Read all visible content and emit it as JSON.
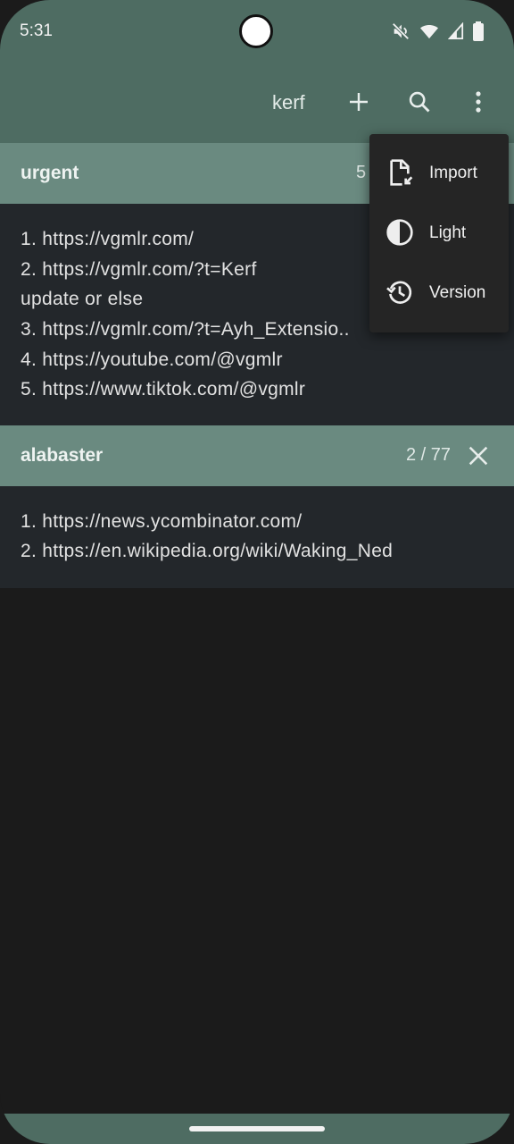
{
  "status_bar": {
    "time": "5:31"
  },
  "app_bar": {
    "title": "kerf"
  },
  "menu": {
    "items": [
      {
        "label": "Import",
        "icon": "file-import-icon"
      },
      {
        "label": "Light",
        "icon": "contrast-icon"
      },
      {
        "label": "Version",
        "icon": "history-icon"
      }
    ]
  },
  "sections": [
    {
      "title": "urgent",
      "count": "5",
      "lines": [
        "1. https://vgmlr.com/",
        "2. https://vgmlr.com/?t=Kerf",
        "update or else",
        "3. https://vgmlr.com/?t=Ayh_Extensio..",
        "4. https://youtube.com/@vgmlr",
        "5. https://www.tiktok.com/@vgmlr"
      ]
    },
    {
      "title": "alabaster",
      "count": "2 / 77",
      "lines": [
        "1. https://news.ycombinator.com/",
        "2. https://en.wikipedia.org/wiki/Waking_Ned"
      ]
    }
  ],
  "colors": {
    "app_bar": "#4e6c62",
    "section_header": "#6a8a80",
    "section_body": "#23272b",
    "background": "#1b1b1b",
    "menu": "#252525"
  }
}
